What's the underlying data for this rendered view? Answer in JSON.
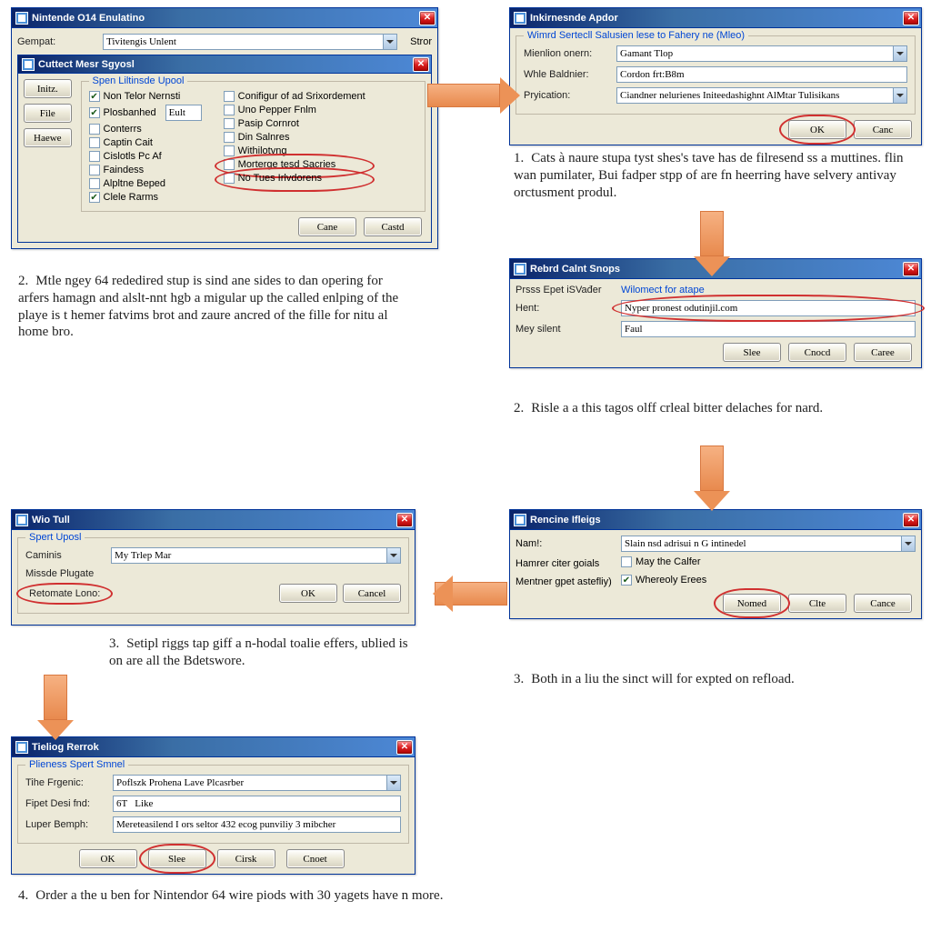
{
  "win1": {
    "title": "Nintende O14 Enulatino",
    "row1_label": "Gempat:",
    "row1_value": "Tivitengis Unlent",
    "row1b_label": "Stror",
    "inner_title": "Cuttect Mesr Sgyosl",
    "side_btns": [
      "Initz.",
      "File",
      "Haewe"
    ],
    "group_legend": "Spen Liltinsde Upool",
    "colA": [
      {
        "label": "Non Telor Nernsti",
        "checked": true
      },
      {
        "label": "Plosbanhed",
        "checked": true,
        "extra": "Eult"
      },
      {
        "label": "Conterrs",
        "checked": false
      },
      {
        "label": "Captin Cait",
        "checked": false
      },
      {
        "label": "Cislotls Pc Af",
        "checked": false
      },
      {
        "label": "Faindess",
        "checked": false
      },
      {
        "label": "Alpltne Beped",
        "checked": false
      },
      {
        "label": "Clele Rarms",
        "checked": true
      }
    ],
    "colB": [
      {
        "label": "Conifigur of ad Srixordement",
        "checked": false
      },
      {
        "label": "Uno Pepper Fnlm",
        "checked": false
      },
      {
        "label": "Pasip Cornrot",
        "checked": false
      },
      {
        "label": "Din Salnres",
        "checked": false
      },
      {
        "label": "Withilotvng",
        "checked": false
      },
      {
        "label": "Morterge tesd Sacries",
        "checked": false,
        "circled": true
      },
      {
        "label": "No Tues Irlvdorens",
        "checked": false,
        "circled": true
      }
    ],
    "btns": [
      "Cane",
      "Castd"
    ]
  },
  "win2": {
    "title": "Inkirnesnde Apdor",
    "group_legend": "Wimrd Sertecll Salusien lese to Fahery ne (Mleo)",
    "rows": [
      {
        "label": "Mienlion onern:",
        "value": "Gamant Tlop",
        "combo": true
      },
      {
        "label": "Whle Baldnier:",
        "value": "Cordon frt:B8m",
        "combo": false
      },
      {
        "label": "Pryication:",
        "value": "Ciandner nelurienes Initeedashighnt AlMtar Tulisikans",
        "combo": true
      }
    ],
    "btns": [
      "OK",
      "Canc"
    ]
  },
  "win3": {
    "title": "Rebrd Calnt Snops",
    "rows": [
      {
        "label": "Prsss Epet iSVađer",
        "value": "Wilomect for atape",
        "header": true
      },
      {
        "label": "Hent:",
        "value": "Nyper pronest odutinjil.com",
        "circled": true
      },
      {
        "label": "Mey silent",
        "value": "Faul"
      }
    ],
    "btns": [
      "Slee",
      "Cnocd",
      "Caree"
    ]
  },
  "win4": {
    "title": "Rencine Ifleigs",
    "rows": [
      {
        "label": "Nam!:",
        "value": "Slain nsd adrisui n G intinedel",
        "combo": true
      }
    ],
    "label_hamrer": "Hamrer citer goials",
    "check_may": "May the Calfer",
    "label_mentner": "Mentner gpet astefliy)",
    "check_whereoly": "Whereoly Erees",
    "btns": [
      "Nomed",
      "Clte",
      "Cance"
    ]
  },
  "win5": {
    "title": "Wio Tull",
    "group_legend": "Spert Uposl",
    "rows": [
      {
        "label": "Caminis",
        "value": "My Trlep Mar",
        "combo": true
      }
    ],
    "label_missde": "Missde Plugate",
    "label_retomate": "Retomate Lono:",
    "btns": [
      "OK",
      "Cancel"
    ]
  },
  "win6": {
    "title": "Tieliog Rerrok",
    "group_legend": "Plieness Spert Smnel",
    "rows": [
      {
        "label": "Tihe Frgenic:",
        "value": "Poflszk Prohena Lave Plcasrber",
        "combo": true
      },
      {
        "label": "Fipet Desi fnd:",
        "value": "6T   Like",
        "combo": false
      },
      {
        "label": "Luper Bemph:",
        "value": "Mereteasilend I ors seltor 432 ecog punviliy 3 mibcher",
        "combo": false
      }
    ],
    "btns": [
      "OK",
      "Slee",
      "Cirsk",
      "Cnoet"
    ]
  },
  "steps": {
    "s1": "Cats à naure stupa tyst shes's tave has de filresend ss a muttines. flin wan pumilater, Bui fadper stpp of are fn heerring have selvery antivay orctusment produl.",
    "s2l": "Mtle ngey 64 rededired stup is sind ane sides to dan opering for arfers hamagn and alslt-nnt hgb a migular up the called enlping of the playe is t hemer fatvims brot and zaure ancred of the fille for nitu al home bro.",
    "s2r": "Risle a a this tagos olff crleal bitter delaches for nard.",
    "s3l": "Setipl riggs tap giff a n-hodal toalie effers, ublied is on are all the Bdetswore.",
    "s3r": "Both in a liu the sinct will for expted on refload.",
    "s4": "Order a the u ben for Nintendor 64 wire piods with 30 yagets have n more."
  }
}
